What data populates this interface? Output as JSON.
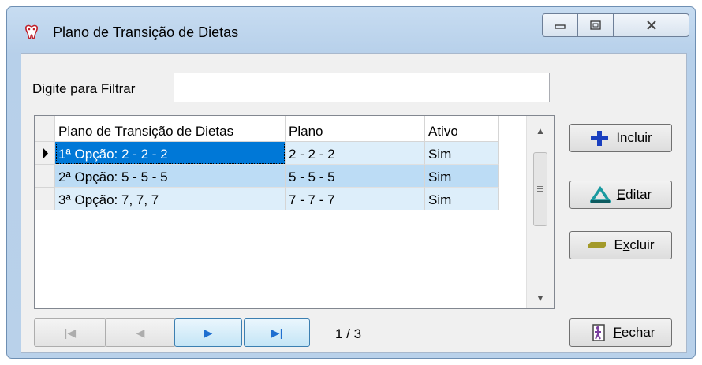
{
  "window": {
    "title": "Plano de Transição de Dietas",
    "controls": {
      "minimize": "▭",
      "maximize": "⧠",
      "close": "✕"
    }
  },
  "filter": {
    "label": "Digite para Filtrar",
    "value": "",
    "placeholder": ""
  },
  "grid": {
    "columns": [
      "Plano de Transição de Dietas",
      "Plano",
      "Ativo"
    ],
    "rows": [
      {
        "name": "1ª Opção: 2 - 2 - 2",
        "plano": "2 - 2 - 2",
        "ativo": "Sim",
        "current": true
      },
      {
        "name": "2ª Opção: 5 - 5 - 5",
        "plano": "5 - 5 - 5",
        "ativo": "Sim",
        "current": false
      },
      {
        "name": "3ª Opção: 7, 7, 7",
        "plano": "7 - 7 - 7",
        "ativo": "Sim",
        "current": false
      }
    ]
  },
  "navigator": {
    "first": "|◀",
    "prev": "◀",
    "next": "▶",
    "last": "▶|",
    "position": "1 / 3"
  },
  "actions": {
    "incluir": {
      "mnemonic": "I",
      "rest": "ncluir",
      "icon": "plus-icon",
      "color": "#1a3fbf"
    },
    "editar": {
      "mnemonic": "E",
      "rest": "ditar",
      "icon": "triangle-icon",
      "color": "#1a9aa0"
    },
    "excluir": {
      "pre": "E",
      "mnemonic": "x",
      "rest": "cluir",
      "icon": "minus-icon",
      "color": "#a39a2a"
    },
    "fechar": {
      "mnemonic": "F",
      "rest": "echar",
      "icon": "exit-door-icon"
    }
  }
}
